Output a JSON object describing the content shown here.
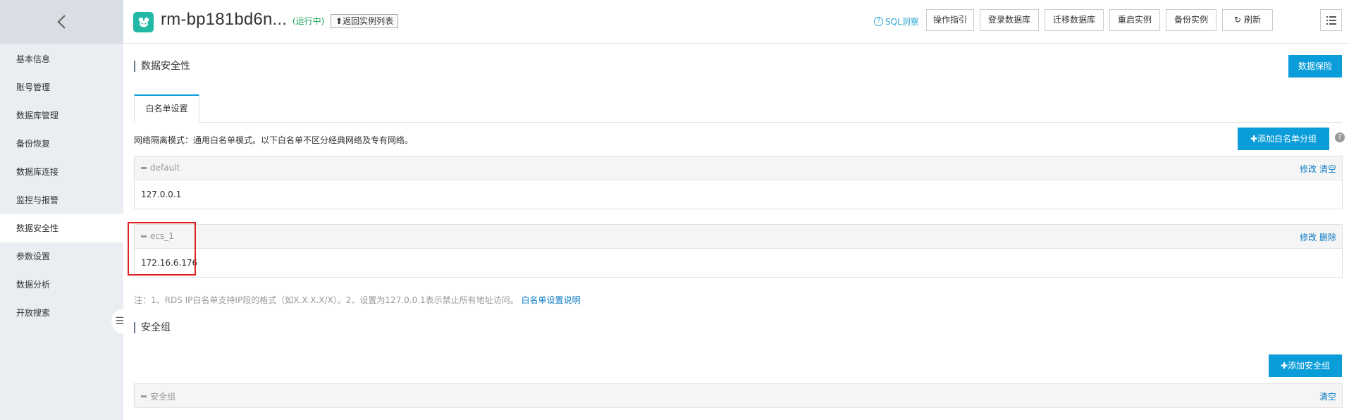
{
  "header": {
    "instance_name": "rm-bp181bd6n...",
    "status": "(运行中)",
    "back_to_list": "返回实例列表",
    "sql_insight": "SQL洞察",
    "buttons": {
      "guide": "操作指引",
      "login_db": "登录数据库",
      "migrate_db": "迁移数据库",
      "restart": "重启实例",
      "backup": "备份实例",
      "refresh": "刷新"
    }
  },
  "sidebar": {
    "items": [
      {
        "label": "基本信息"
      },
      {
        "label": "账号管理"
      },
      {
        "label": "数据库管理"
      },
      {
        "label": "备份恢复"
      },
      {
        "label": "数据库连接"
      },
      {
        "label": "监控与报警"
      },
      {
        "label": "数据安全性"
      },
      {
        "label": "参数设置"
      },
      {
        "label": "数据分析"
      },
      {
        "label": "开放搜索"
      }
    ]
  },
  "main": {
    "title": "数据安全性",
    "data_insurance_btn": "数据保险",
    "tab_whitelist": "白名单设置",
    "mode_text": "网络隔离模式：通用白名单模式。以下白名单不区分经典网络及专有网络。",
    "add_whitelist_group_btn": "添加白名单分组",
    "groups": [
      {
        "name": "default",
        "ip": "127.0.0.1",
        "action1": "修改",
        "action2": "清空"
      },
      {
        "name": "ecs_1",
        "ip": "172.16.6.176",
        "action1": "修改",
        "action2": "删除"
      }
    ],
    "note_text": "注：1、RDS IP白名单支持IP段的格式（如X.X.X.X/X）。2、设置为127.0.0.1表示禁止所有地址访问。",
    "note_link": "白名单设置说明",
    "security_group_title": "安全组",
    "add_security_group_btn": "添加安全组",
    "security_group_row": {
      "name": "安全组",
      "action": "清空"
    }
  },
  "colors": {
    "primary": "#0a9dd9",
    "link": "#0a7bc5",
    "status_green": "#1aa35a",
    "highlight_red": "#e02020",
    "sidebar_bg": "#eaedf1"
  }
}
